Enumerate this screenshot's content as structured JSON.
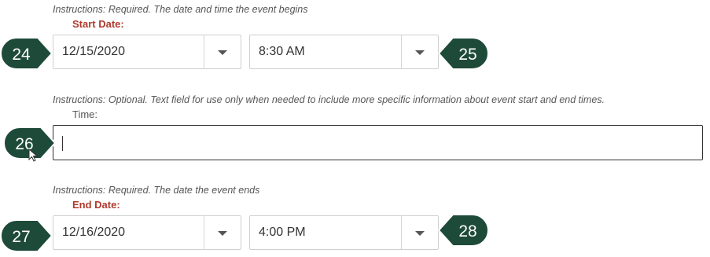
{
  "start": {
    "instructions": "Instructions: Required. The date and time the event begins",
    "label": "Start Date:",
    "date_value": "12/15/2020",
    "time_value": "8:30 AM",
    "date_marker": "24",
    "time_marker": "25"
  },
  "time_field": {
    "instructions": "Instructions: Optional. Text field for use only when needed to include more specific information about event start and end times.",
    "label": "Time:",
    "value": "",
    "marker": "26"
  },
  "end": {
    "instructions": "Instructions: Required. The date the event ends",
    "label": "End Date:",
    "date_value": "12/16/2020",
    "time_value": "4:00 PM",
    "date_marker": "27",
    "time_marker": "28"
  },
  "colors": {
    "required_label": "#b03a2e",
    "marker_fill": "#1e4a3a"
  },
  "icons": {
    "dropdown": "chevron-down-icon",
    "pointer": "mouse-pointer-icon"
  }
}
